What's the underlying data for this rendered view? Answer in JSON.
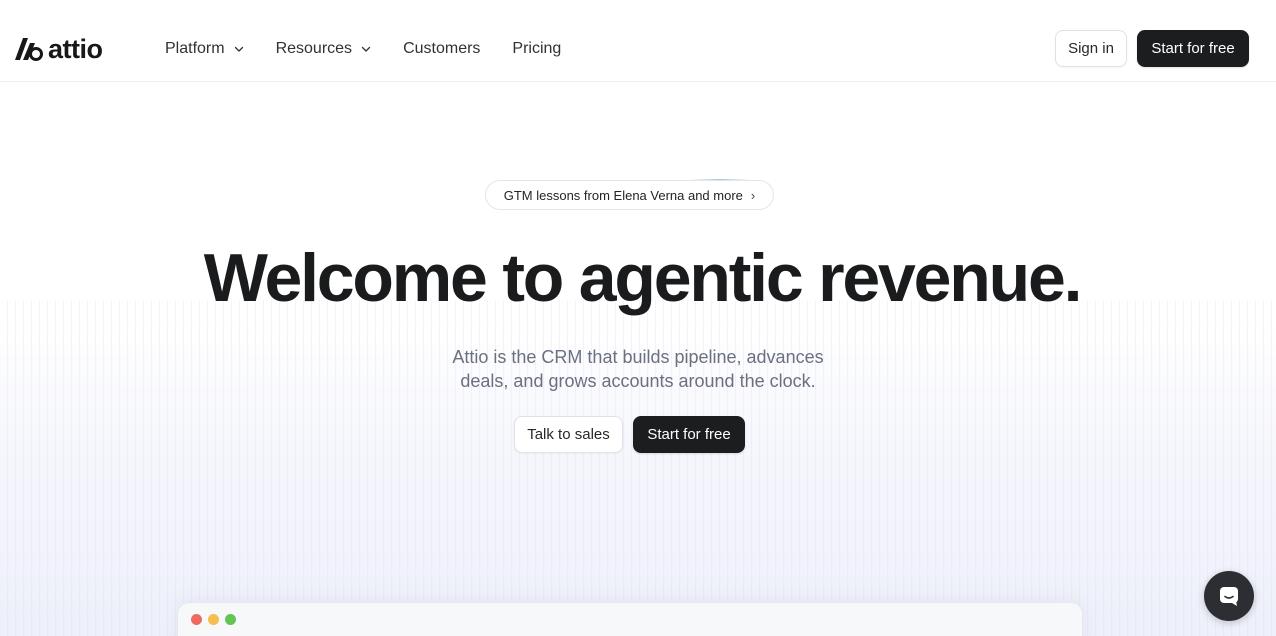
{
  "brand": {
    "name": "attio",
    "icon": "attio-logo-icon"
  },
  "nav": {
    "items": [
      {
        "label": "Platform",
        "has_dropdown": true
      },
      {
        "label": "Resources",
        "has_dropdown": true
      },
      {
        "label": "Customers",
        "has_dropdown": false
      },
      {
        "label": "Pricing",
        "has_dropdown": false
      }
    ],
    "sign_in_label": "Sign in",
    "start_label": "Start for free"
  },
  "hero": {
    "announcement": "GTM lessons from Elena Verna and more",
    "headline": "Welcome to agentic revenue.",
    "subline_1": "Attio is the CRM that builds pipeline, advances",
    "subline_2": "deals, and grows accounts around the clock.",
    "talk_label": "Talk to sales",
    "start_label": "Start for free"
  },
  "preview": {
    "window_dots": [
      "#ee6a5f",
      "#f5be4f",
      "#62c554"
    ]
  },
  "chat": {
    "icon": "chat-icon"
  },
  "colors": {
    "text_dark": "#1c1d1f",
    "subtext": "#6b7080",
    "button_dark": "#1c1d1f",
    "border": "#dfe1e5"
  }
}
